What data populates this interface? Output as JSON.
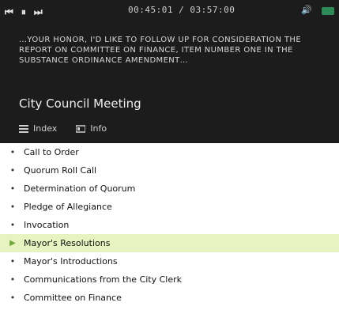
{
  "header": {
    "player": {
      "prev_label": "⏮",
      "pause_label": "⏸",
      "next_label": "⏭",
      "time": "00:45:01 / 03:57:00",
      "volume": "🔊"
    },
    "caption": "…YOUR HONOR, I'D LIKE TO FOLLOW UP FOR CONSIDERATION THE REPORT ON COMMITTEE ON FINANCE, ITEM NUMBER ONE IN THE SUBSTANCE ORDINANCE AMENDMENT…",
    "title": "City Council Meeting",
    "tabs": [
      {
        "label": "Index"
      },
      {
        "label": "Info"
      }
    ]
  },
  "agenda": {
    "items": [
      {
        "label": "Call to Order"
      },
      {
        "label": "Quorum Roll Call"
      },
      {
        "label": "Determination of Quorum"
      },
      {
        "label": "Pledge of Allegiance"
      },
      {
        "label": "Invocation"
      },
      {
        "label": "Mayor's Resolutions",
        "active": true
      },
      {
        "label": "Mayor's Introductions"
      },
      {
        "label": "Communications from the City Clerk"
      },
      {
        "label": "Committee on Finance"
      }
    ],
    "overlay_text": ""
  },
  "colors": {
    "header_bg": "#1c1c1c",
    "active_row_bg": "#e7f3c1",
    "active_marker": "#6ea83a"
  }
}
